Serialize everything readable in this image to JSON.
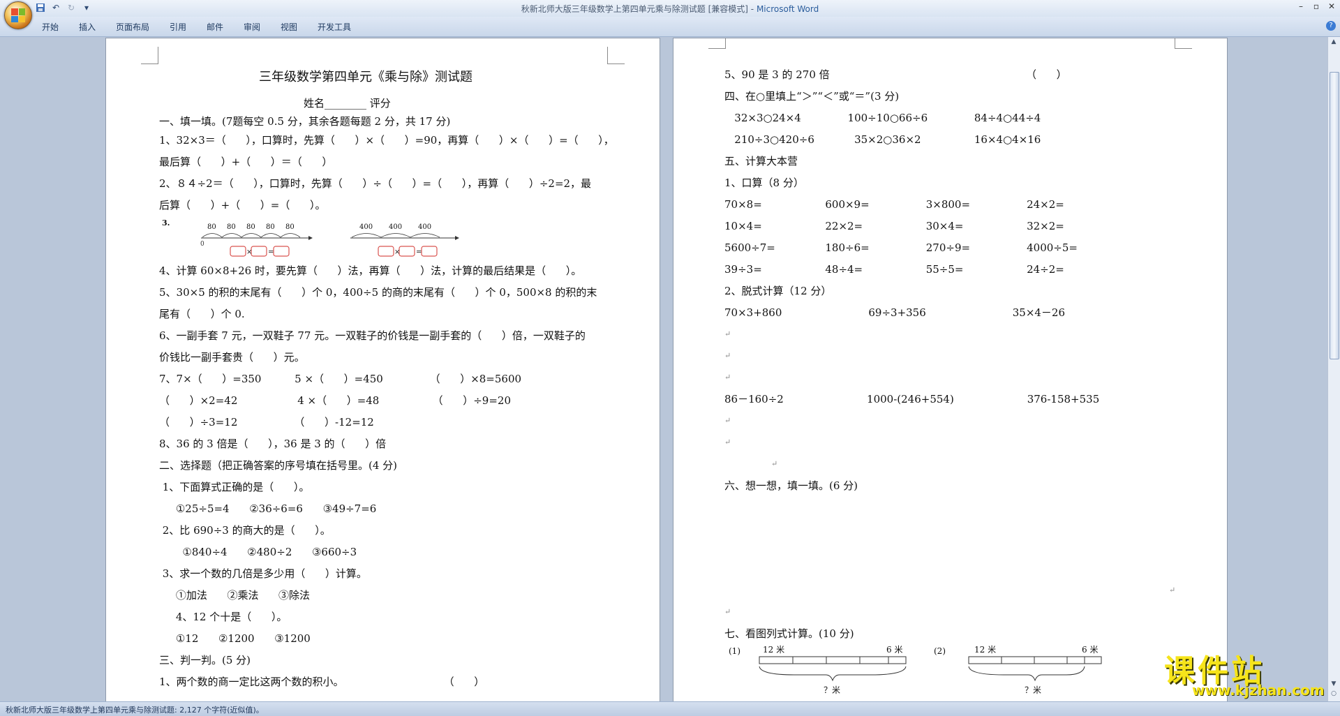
{
  "window": {
    "title": "秋新北师大版三年级数学上第四单元乘与除测试题 [兼容模式]",
    "app_name": "Microsoft Word",
    "separator": " - "
  },
  "ribbon": {
    "tabs": [
      "开始",
      "插入",
      "页面布局",
      "引用",
      "邮件",
      "审阅",
      "视图",
      "开发工具"
    ]
  },
  "status": {
    "text": "秋新北师大版三年级数学上第四单元乘与除测试题: 2,127 个字符(近似值)。"
  },
  "watermark": {
    "title": "课件站",
    "url": "www.kjzhan.com"
  },
  "marks": {
    "para": "↵"
  },
  "doc": {
    "left": {
      "title": "三年级数学第四单元《乘与除》测试题",
      "name_line": "姓名________ 评分",
      "lines": [
        "一、填一填。(7题每空 0.5 分，其余各题每题 2 分，共 17 分)",
        "1、32×3＝（      ），口算时，先算（      ）×（      ）=90，再算（      ）×（      ）=（      ），",
        "最后算（      ）+（      ）＝（      ）",
        "2、８４÷2＝（      ），口算时，先算（      ）÷（      ）=（      ），再算（      ）÷2=2，最",
        "后算（      ）+（      ）=（      ）。",
        "4、计算 60×8+26 时，要先算（      ）法，再算（      ）法，计算的最后结果是（      ）。",
        "5、30×5 的积的末尾有（      ）个 0，400÷5 的商的末尾有（      ）个 0，500×8 的积的末",
        "尾有（      ）个 0.",
        "6、一副手套 7 元，一双鞋子 77 元。一双鞋子的价钱是一副手套的（      ）倍，一双鞋子的",
        "价钱比一副手套贵（      ）元。",
        "7、7×（      ）=350          5 ×（      ）=450              （      ）×8=5600",
        "（      ）×2=42                  4 ×（      ）=48                （      ）÷9=20",
        "（      ）÷3=12                 （      ）-12=12",
        "8、36 的 3 倍是（      ），36 是 3 的（      ）倍",
        "二、选择题（把正确答案的序号填在括号里。(4 分)",
        " 1、下面算式正确的是（      ）。",
        "     ①25÷5=4      ②36÷6=6      ③49÷7=6",
        " 2、比 690÷3 的商大的是（      ）。",
        "       ①840÷4      ②480÷2      ③660÷3",
        " 3、求一个数的几倍是多少用（      ）计算。",
        "     ①加法      ②乘法      ③除法",
        "     4、12 个十是（      ）。",
        "     ①12      ②1200      ③1200",
        "三、判一判。(5 分)",
        "1、两个数的商一定比这两个数的积小。                              （      ）"
      ],
      "diagram": {
        "num": "3.",
        "tick": "80",
        "tick2": "400",
        "zero": "0",
        "times": "×",
        "eq": "="
      }
    },
    "right": {
      "lines": [
        "5、90 是 3 的 270 倍                                                           （      ）",
        "四、在○里填上“＞”“＜”或“＝”(3 分)",
        "   32×3○24×4              100÷10○66÷6              84÷4○44÷4",
        "   210÷3○420÷6            35×2○36×2                16×4○4×16",
        "五、计算大本营",
        "1、口算（8 分）",
        "70×8=                   600×9=                 3×800=                 24×2=",
        "10×4=                   22×2=                   30×4=                   32×2=",
        "5600÷7=               180÷6=                 270÷9=                 4000÷5=",
        "39÷3=                   48÷4=                   55÷5=                   24÷2=",
        "2、脱式计算（12 分）",
        "70×3+860                          69÷3+356                          35×4－26",
        "86－160÷2                         1000-(246+554)                      376-158+535",
        "六、想一想，填一填。(6 分)",
        "七、看图列式计算。(10 分)"
      ],
      "bar1": {
        "num": "(1)",
        "left_label": "12 米",
        "right_label": "6 米",
        "bottom": "？米"
      },
      "bar2": {
        "num": "(2)",
        "left_label": "12 米",
        "right_label": "6 米",
        "bottom": "？米"
      }
    }
  }
}
